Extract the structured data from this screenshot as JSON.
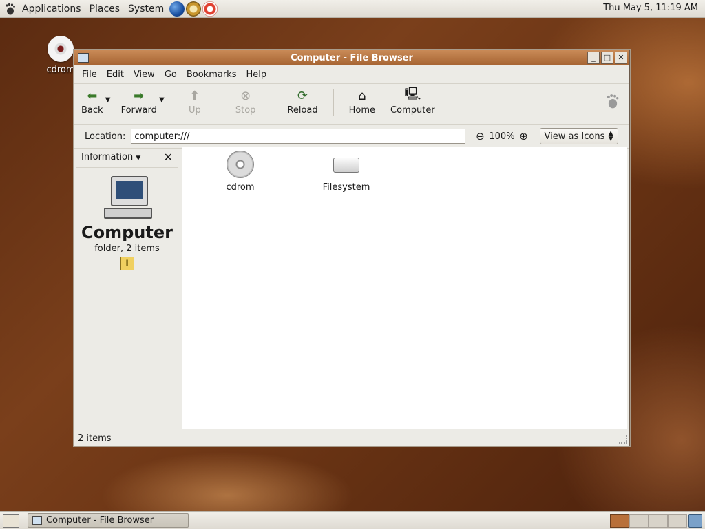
{
  "top_panel": {
    "menus": [
      "Applications",
      "Places",
      "System"
    ],
    "clock": "Thu May  5, 11:19 AM",
    "launchers": [
      "web-browser-icon",
      "mail-icon",
      "help-icon"
    ]
  },
  "desktop": {
    "icons": [
      {
        "label": "cdrom",
        "icon": "cd-icon"
      }
    ]
  },
  "window": {
    "title": "Computer - File Browser",
    "menubar": [
      "File",
      "Edit",
      "View",
      "Go",
      "Bookmarks",
      "Help"
    ],
    "toolbar": {
      "back": "Back",
      "forward": "Forward",
      "up": "Up",
      "stop": "Stop",
      "reload": "Reload",
      "home": "Home",
      "computer": "Computer"
    },
    "location": {
      "label": "Location:",
      "value": "computer:///"
    },
    "zoom": "100%",
    "view_mode": "View as Icons",
    "sidepane": {
      "selector": "Information",
      "title": "Computer",
      "subtitle": "folder, 2 items"
    },
    "items": [
      {
        "label": "cdrom",
        "icon": "cd-icon"
      },
      {
        "label": "Filesystem",
        "icon": "drive-icon"
      }
    ],
    "status": "2 items"
  },
  "bottom_panel": {
    "task": "Computer - File Browser",
    "workspaces": 4,
    "active_workspace": 1
  },
  "colors": {
    "titlebar": "#b8703a",
    "panel": "#e8e5df",
    "desktop": "#6a3414"
  }
}
